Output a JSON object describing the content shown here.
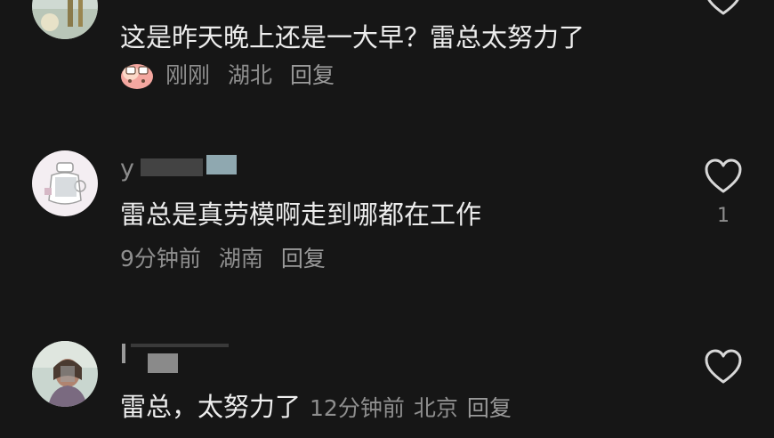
{
  "comments": [
    {
      "username": "",
      "text": "这是昨天晚上还是一大早？雷总太努力了",
      "meta": {
        "time": "刚刚",
        "location": "湖北",
        "reply": "回复"
      },
      "likes": ""
    },
    {
      "username": "y",
      "text": "雷总是真劳模啊走到哪都在工作",
      "meta": {
        "time": "9分钟前",
        "location": "湖南",
        "reply": "回复"
      },
      "likes": "1"
    },
    {
      "username": "",
      "text": "雷总，太努力了",
      "meta": {
        "time": "12分钟前",
        "location": "北京",
        "reply": "回复"
      },
      "likes": ""
    }
  ],
  "icons": {
    "like": "heart-outline-icon",
    "sticker": "peach-sticker-icon"
  },
  "colors": {
    "background": "#161616",
    "text_primary": "#ededed",
    "text_secondary": "#8e8e8e"
  }
}
